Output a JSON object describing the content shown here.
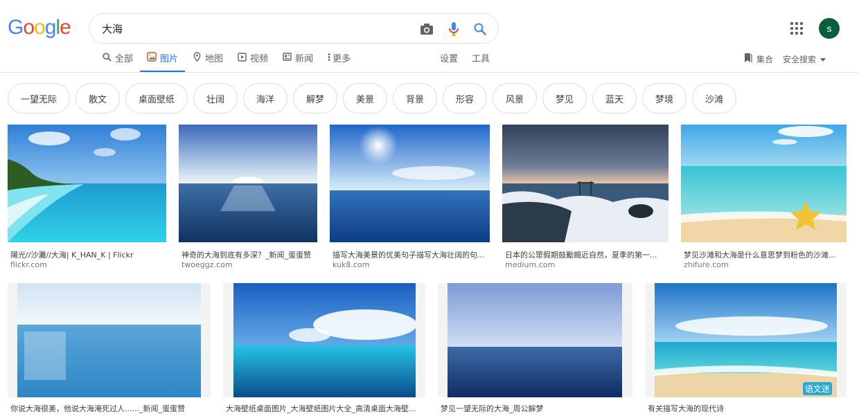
{
  "logo": {
    "letters": [
      "G",
      "o",
      "o",
      "g",
      "l",
      "e"
    ],
    "colors": [
      "#4285f4",
      "#ea4335",
      "#fbbc05",
      "#4285f4",
      "#34a853",
      "#ea4335"
    ]
  },
  "search": {
    "query": "大海"
  },
  "icons": {
    "camera": "camera-icon",
    "mic": "microphone-icon",
    "search": "search-icon",
    "apps": "apps-grid-icon"
  },
  "account": {
    "avatar_letter": "s"
  },
  "tabs": [
    {
      "label": "全部",
      "icon": "search-icon",
      "active": false
    },
    {
      "label": "图片",
      "icon": "image-icon",
      "active": true
    },
    {
      "label": "地图",
      "icon": "map-pin-icon",
      "active": false
    },
    {
      "label": "视频",
      "icon": "video-icon",
      "active": false
    },
    {
      "label": "新闻",
      "icon": "news-icon",
      "active": false
    },
    {
      "label": "更多",
      "icon": "more-icon",
      "active": false
    }
  ],
  "tools": {
    "settings": "设置",
    "tools": "工具"
  },
  "right_links": {
    "collections": "集合",
    "safe_search": "安全搜索"
  },
  "chips": [
    "一望无际",
    "散文",
    "桌面壁纸",
    "壮阔",
    "海洋",
    "解梦",
    "美景",
    "背景",
    "形容",
    "风景",
    "梦见",
    "蓝天",
    "梦境",
    "沙滩"
  ],
  "results_row1": [
    {
      "caption": "陽光//沙灘//大海| K_HAN_K | Flickr",
      "domain": "flickr.com"
    },
    {
      "caption": "神奇的大海到底有多深？_新闻_蛋蛋赞",
      "domain": "twoeggz.com"
    },
    {
      "caption": "描写大海美景的优美句子描写大海壮阔的句...",
      "domain": "kuk8.com"
    },
    {
      "caption": "日本的公眾假期鼓勵親近自然，夏季的第一...",
      "domain": "medium.com"
    },
    {
      "caption": "梦见沙滩和大海是什么意思梦到粉色的沙滩...",
      "domain": "zhifure.com"
    }
  ],
  "results_row2": [
    {
      "caption": "你说大海很美，他说大海淹死过人......_新闻_蛋蛋赞"
    },
    {
      "caption": "大海壁纸桌面图片_大海壁纸图片大全_高清桌面大海壁..."
    },
    {
      "caption": "梦见一望无际的大海_周公解梦"
    },
    {
      "caption": "有关描写大海的现代诗",
      "watermark": "语文迷"
    }
  ]
}
